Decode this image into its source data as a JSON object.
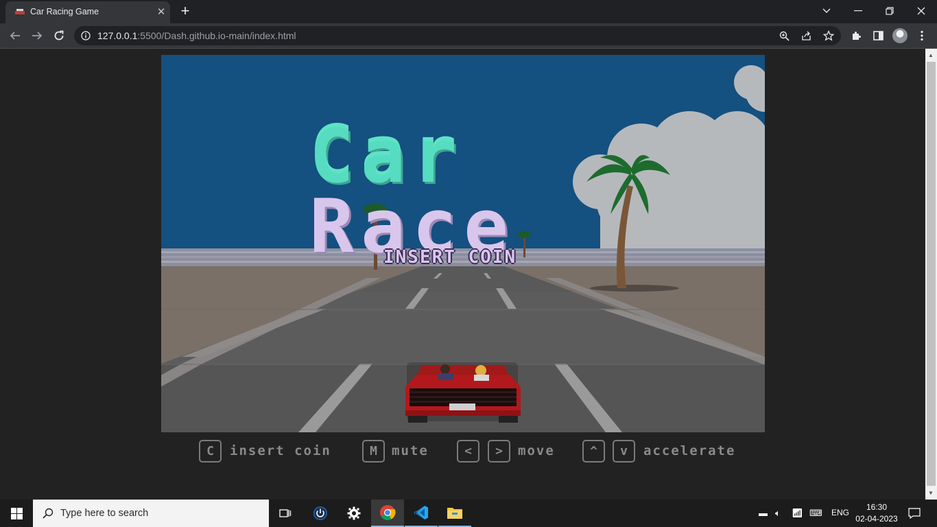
{
  "browser": {
    "tab_title": "Car Racing Game",
    "url_host": "127.0.0.1",
    "url_rest": ":5500/Dash.github.io-main/index.html"
  },
  "game": {
    "title_line1": "Car",
    "title_line2": "Race",
    "prompt": "INSERT COIN",
    "colors": {
      "sky": "#145080",
      "sand": "#7a7068",
      "road": "#5a5a5a",
      "logo_top": "#56dcc0",
      "logo_bottom": "#d9c6ec"
    }
  },
  "controls": {
    "insert_key": "C",
    "insert_label": "insert coin",
    "mute_key": "M",
    "mute_label": "mute",
    "left_key": "<",
    "right_key": ">",
    "move_label": "move",
    "up_key": "^",
    "down_key": "v",
    "accelerate_label": "accelerate"
  },
  "taskbar": {
    "search_placeholder": "Type here to search",
    "language": "ENG",
    "time": "16:30",
    "date": "02-04-2023"
  }
}
